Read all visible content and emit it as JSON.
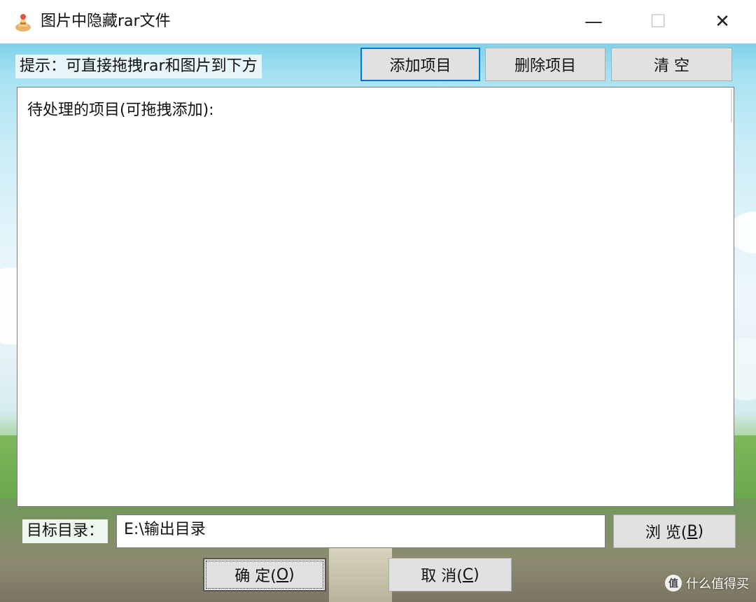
{
  "window": {
    "title": "图片中隐藏rar文件",
    "minimize_glyph": "—",
    "maximize_glyph": "☐",
    "close_glyph": "✕"
  },
  "toolbar": {
    "hint": "提示：可直接拖拽rar和图片到下方",
    "add_label": "添加项目",
    "delete_label": "删除项目",
    "clear_label": "清 空"
  },
  "list": {
    "caption": "待处理的项目(可拖拽添加):"
  },
  "target": {
    "label": "目标目录：",
    "path_value": "E:\\输出目录",
    "browse_prefix": "浏 览(",
    "browse_key": "B",
    "browse_suffix": ")"
  },
  "footer": {
    "ok_prefix": "确 定(",
    "ok_key": "O",
    "ok_suffix": ")",
    "cancel_prefix": "取 消(",
    "cancel_key": "C",
    "cancel_suffix": ")"
  },
  "watermark": {
    "icon": "值",
    "text": "什么值得买"
  },
  "icons": {
    "app": "app-icon",
    "minimize": "minimize-icon",
    "maximize": "maximize-icon",
    "close": "close-icon"
  },
  "colors": {
    "focus_border": "#0078d7",
    "button_face": "#e1e1e1",
    "sky": "#a8e2f2",
    "grass": "#7fb85a"
  }
}
